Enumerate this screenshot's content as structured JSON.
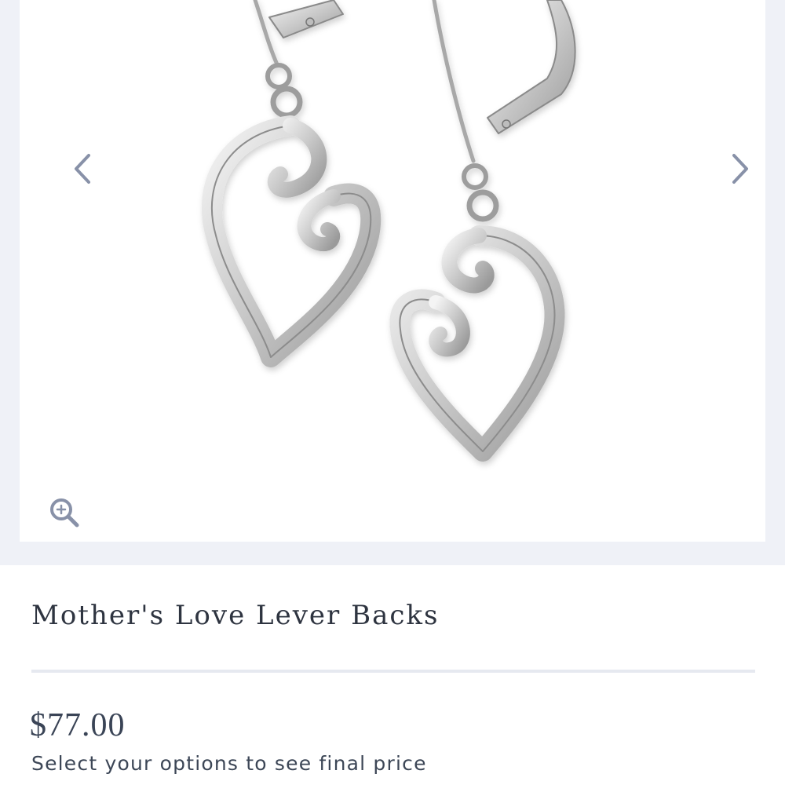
{
  "gallery": {
    "image_alt": "Mother's Love Lever Backs earrings",
    "prev_icon": "chevron-left-icon",
    "next_icon": "chevron-right-icon",
    "zoom_icon": "zoom-in-icon",
    "accent_color": "#8891a8"
  },
  "product": {
    "title": "Mother's Love Lever Backs",
    "price": "$77.00",
    "price_note": "Select your options to see final price"
  }
}
